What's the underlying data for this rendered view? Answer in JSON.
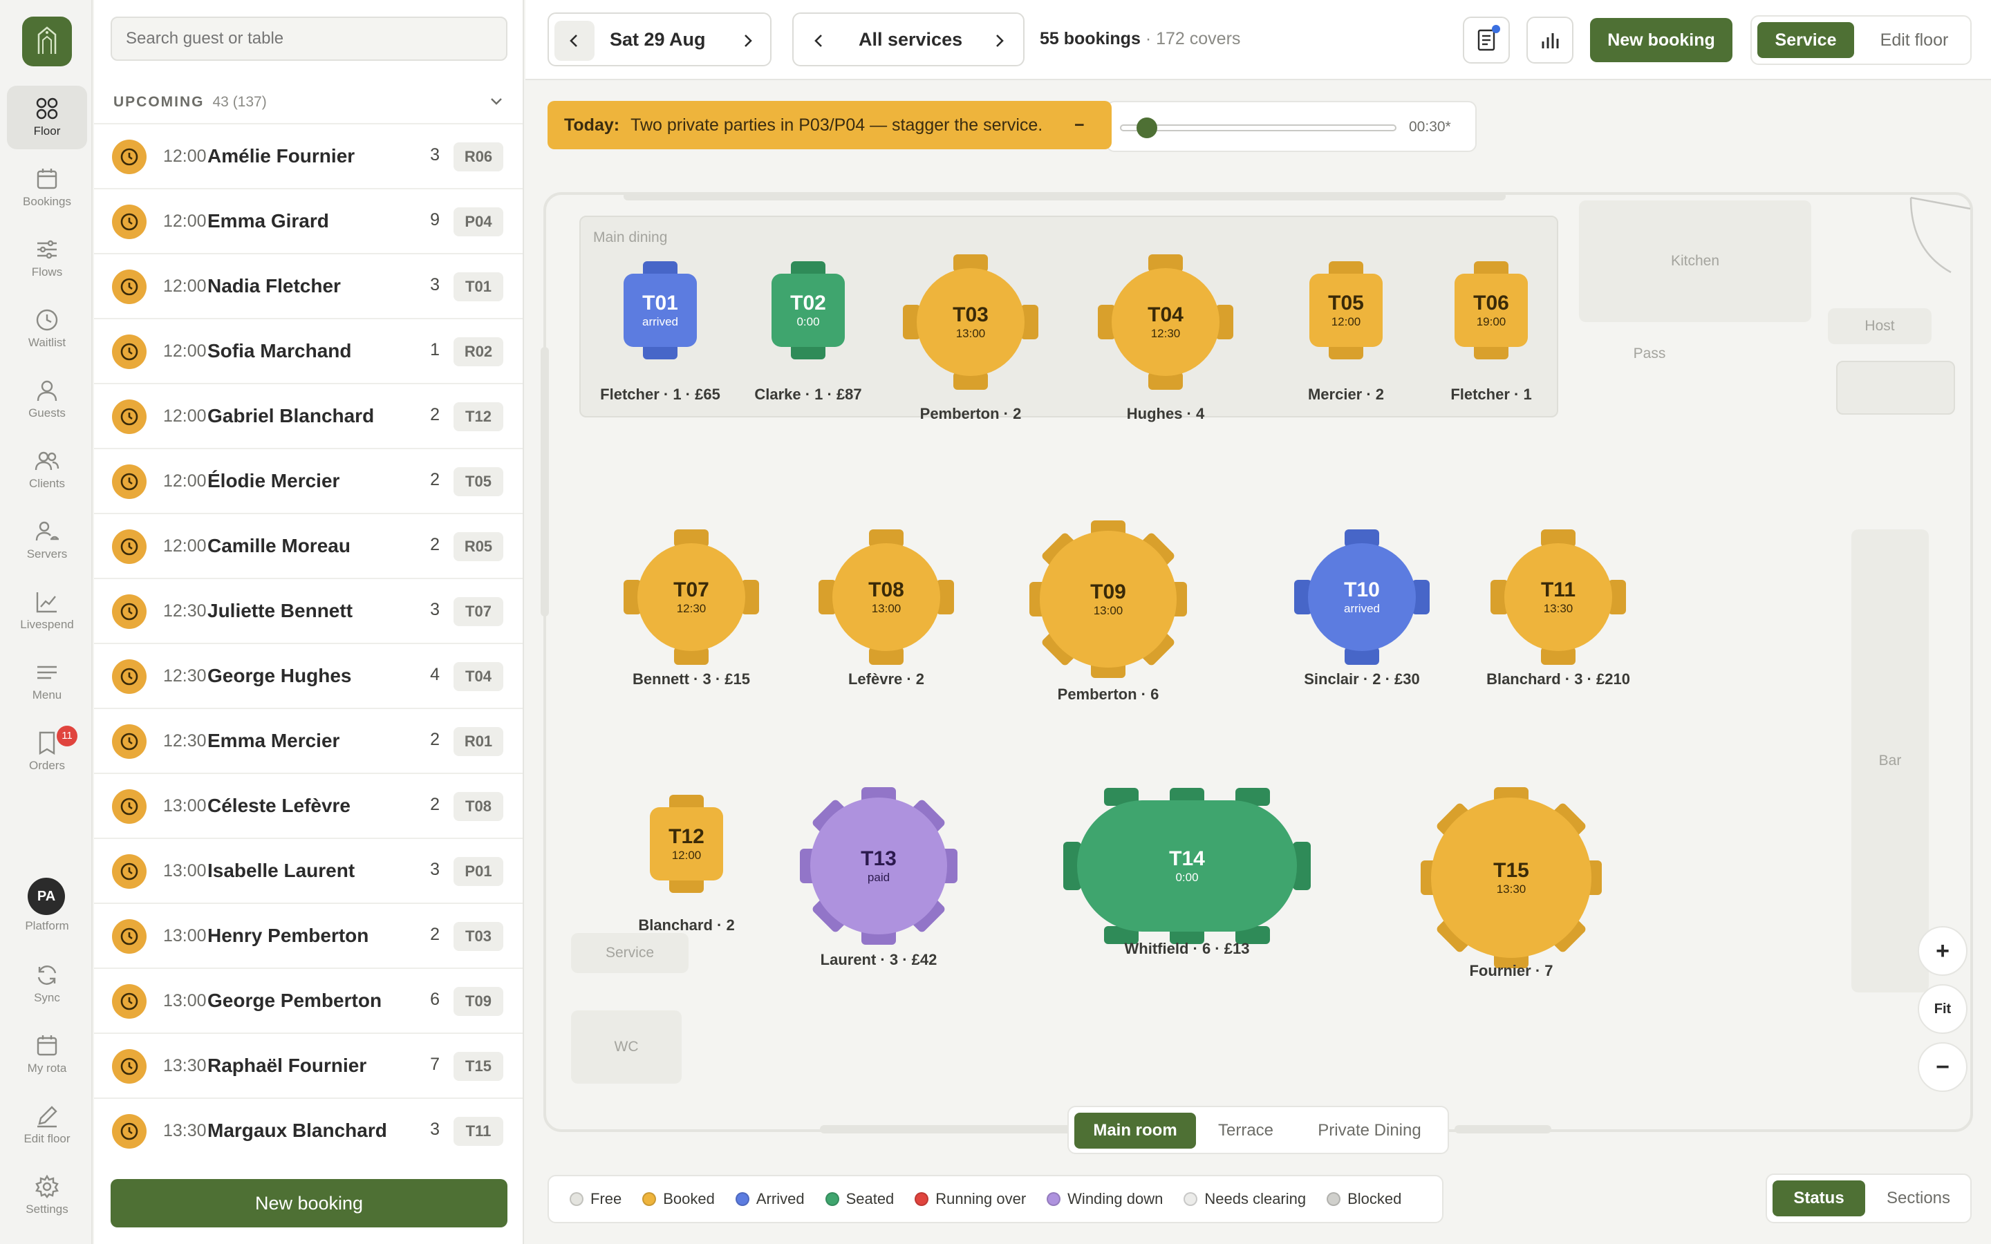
{
  "nav": {
    "items": [
      {
        "label": "Floor",
        "icon": "floor-icon",
        "active": true
      },
      {
        "label": "Bookings",
        "icon": "calendar-icon"
      },
      {
        "label": "Flows",
        "icon": "flows-icon"
      },
      {
        "label": "Waitlist",
        "icon": "clock-icon"
      },
      {
        "label": "Guests",
        "icon": "person-icon"
      },
      {
        "label": "Clients",
        "icon": "clients-icon"
      },
      {
        "label": "Servers",
        "icon": "servers-icon"
      },
      {
        "label": "Livespend",
        "icon": "chart-line-icon"
      },
      {
        "label": "Menu",
        "icon": "menu-icon"
      },
      {
        "label": "Orders",
        "icon": "receipt-icon",
        "badge": "11"
      }
    ],
    "avatar_initials": "PA",
    "bottom_items": [
      {
        "label": "Platform",
        "icon": "avatar-icon"
      },
      {
        "label": "Sync",
        "icon": "sync-icon"
      },
      {
        "label": "My rota",
        "icon": "calendar-icon"
      },
      {
        "label": "Edit floor",
        "icon": "pencil-icon"
      },
      {
        "label": "Settings",
        "icon": "gear-icon"
      }
    ]
  },
  "sidebar": {
    "search_placeholder": "Search guest or table",
    "section_title": "UPCOMING",
    "section_count": "43 (137)",
    "bookings": [
      {
        "time": "12:00",
        "name": "Amélie Fournier",
        "covers": "3",
        "table": "R06"
      },
      {
        "time": "12:00",
        "name": "Emma Girard",
        "covers": "9",
        "table": "P04"
      },
      {
        "time": "12:00",
        "name": "Nadia Fletcher",
        "covers": "3",
        "table": "T01"
      },
      {
        "time": "12:00",
        "name": "Sofia Marchand",
        "covers": "1",
        "table": "R02"
      },
      {
        "time": "12:00",
        "name": "Gabriel Blanchard",
        "covers": "2",
        "table": "T12"
      },
      {
        "time": "12:00",
        "name": "Élodie Mercier",
        "covers": "2",
        "table": "T05"
      },
      {
        "time": "12:00",
        "name": "Camille Moreau",
        "covers": "2",
        "table": "R05"
      },
      {
        "time": "12:30",
        "name": "Juliette Bennett",
        "covers": "3",
        "table": "T07"
      },
      {
        "time": "12:30",
        "name": "George Hughes",
        "covers": "4",
        "table": "T04"
      },
      {
        "time": "12:30",
        "name": "Emma Mercier",
        "covers": "2",
        "table": "R01"
      },
      {
        "time": "13:00",
        "name": "Céleste Lefèvre",
        "covers": "2",
        "table": "T08"
      },
      {
        "time": "13:00",
        "name": "Isabelle Laurent",
        "covers": "3",
        "table": "P01"
      },
      {
        "time": "13:00",
        "name": "Henry Pemberton",
        "covers": "2",
        "table": "T03"
      },
      {
        "time": "13:00",
        "name": "George Pemberton",
        "covers": "6",
        "table": "T09"
      },
      {
        "time": "13:30",
        "name": "Raphaël Fournier",
        "covers": "7",
        "table": "T15"
      },
      {
        "time": "13:30",
        "name": "Margaux Blanchard",
        "covers": "3",
        "table": "T11"
      }
    ],
    "new_booking": "New booking"
  },
  "header": {
    "date": "Sat 29 Aug",
    "service": "All services",
    "bookings_count": "55 bookings",
    "covers": "· 172 covers",
    "new_booking": "New booking",
    "mode_service": "Service",
    "mode_edit": "Edit floor"
  },
  "alert": {
    "prefix": "Today:",
    "text": "Two private parties in P03/P04 — stagger the service.",
    "collapse": "−"
  },
  "timeline": {
    "offset_label": "00:30*",
    "position": 0.06
  },
  "floor": {
    "zones": {
      "main_dining": "Main dining",
      "kitchen": "Kitchen",
      "pass": "Pass",
      "host": "Host",
      "bar": "Bar",
      "service": "Service",
      "wc": "WC"
    },
    "tables": [
      {
        "id": "T01",
        "sub": "arrived",
        "label": "Fletcher · 1 · £65"
      },
      {
        "id": "T02",
        "sub": "0:00",
        "label": "Clarke · 1 · £87"
      },
      {
        "id": "T03",
        "sub": "13:00",
        "label": "Pemberton · 2"
      },
      {
        "id": "T04",
        "sub": "12:30",
        "label": "Hughes · 4"
      },
      {
        "id": "T05",
        "sub": "12:00",
        "label": "Mercier · 2"
      },
      {
        "id": "T06",
        "sub": "19:00",
        "label": "Fletcher · 1"
      },
      {
        "id": "T07",
        "sub": "12:30",
        "label": "Bennett · 3 · £15"
      },
      {
        "id": "T08",
        "sub": "13:00",
        "label": "Lefèvre · 2"
      },
      {
        "id": "T09",
        "sub": "13:00",
        "label": "Pemberton · 6"
      },
      {
        "id": "T10",
        "sub": "arrived",
        "label": "Sinclair · 2 · £30"
      },
      {
        "id": "T11",
        "sub": "13:30",
        "label": "Blanchard · 3 · £210"
      },
      {
        "id": "T12",
        "sub": "12:00",
        "label": "Blanchard · 2"
      },
      {
        "id": "T13",
        "sub": "paid",
        "label": "Laurent · 3 · £42"
      },
      {
        "id": "T14",
        "sub": "0:00",
        "label": "Whitfield · 6 · £13"
      },
      {
        "id": "T15",
        "sub": "13:30",
        "label": "Fournier · 7"
      }
    ]
  },
  "zoom": {
    "in": "+",
    "fit": "Fit",
    "out": "−"
  },
  "rooms": {
    "main": "Main room",
    "terrace": "Terrace",
    "private": "Private Dining"
  },
  "legend": [
    {
      "label": "Free",
      "color": "#e4e4df"
    },
    {
      "label": "Booked",
      "color": "#eeb43c"
    },
    {
      "label": "Arrived",
      "color": "#5c7ce0"
    },
    {
      "label": "Seated",
      "color": "#3fa56e"
    },
    {
      "label": "Running over",
      "color": "#e0443e"
    },
    {
      "label": "Winding down",
      "color": "#ae92de"
    },
    {
      "label": "Needs clearing",
      "color": "#ececea"
    },
    {
      "label": "Blocked",
      "color": "#d0d0cc"
    }
  ],
  "view": {
    "status": "Status",
    "sections": "Sections"
  },
  "colors": {
    "accent": "#4e7034",
    "booked": "#eeb43c"
  }
}
